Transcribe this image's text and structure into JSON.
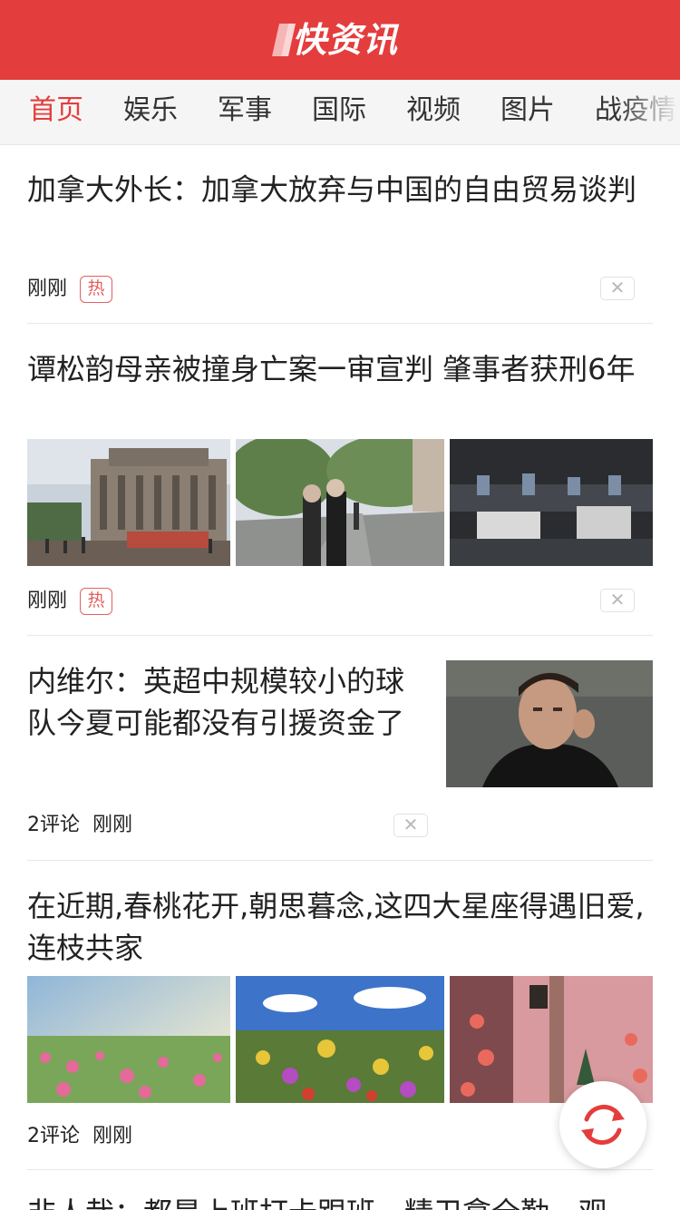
{
  "app": {
    "logo_text": "快资讯"
  },
  "nav": {
    "tabs": [
      {
        "label": "首页",
        "active": true
      },
      {
        "label": "娱乐"
      },
      {
        "label": "军事"
      },
      {
        "label": "国际"
      },
      {
        "label": "视频"
      },
      {
        "label": "图片"
      },
      {
        "label": "战疫情"
      }
    ]
  },
  "feed": [
    {
      "title": "加拿大外长：加拿大放弃与中国的自由贸易谈判",
      "time": "刚刚",
      "badge": "热"
    },
    {
      "title": "谭松韵母亲被撞身亡案一审宣判 肇事者获刑6年",
      "time": "刚刚",
      "badge": "热"
    },
    {
      "title": "内维尔：英超中规模较小的球队今夏可能都没有引援资金了",
      "comments": "2评论",
      "time": "刚刚"
    },
    {
      "title": "在近期,春桃花开,朝思暮念,这四大星座得遇旧爱,连枝共家",
      "comments": "2评论",
      "time": "刚刚"
    },
    {
      "title": "非人哉：都是上班打卡跟班，精卫拿全勤，观"
    }
  ],
  "colors": {
    "brand": "#e43d3d",
    "hot": "#e46060"
  },
  "icons": {
    "close": "close-icon",
    "refresh": "refresh-icon"
  }
}
